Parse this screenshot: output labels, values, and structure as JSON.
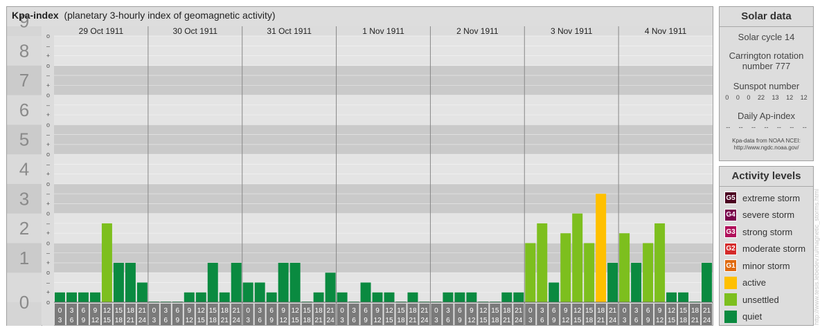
{
  "header": {
    "title_bold": "Kpa-index",
    "title_rest": "(planetary 3-hourly index of geomagnetic activity)"
  },
  "chart_data": {
    "type": "bar",
    "ylim": [
      0,
      9
    ],
    "y_ticks": [
      "0",
      "1",
      "2",
      "3",
      "4",
      "5",
      "6",
      "7",
      "8",
      "9"
    ],
    "sub_ticks": [
      "o",
      "+",
      "–"
    ],
    "days": [
      "29 Oct 1911",
      "30 Oct 1911",
      "31 Oct 1911",
      "1 Nov 1911",
      "2 Nov 1911",
      "3 Nov 1911",
      "4 Nov 1911"
    ],
    "hour_start": [
      "0",
      "3",
      "6",
      "9",
      "12",
      "15",
      "18",
      "21"
    ],
    "hour_end": [
      "3",
      "6",
      "9",
      "12",
      "15",
      "18",
      "21",
      "24"
    ],
    "values": [
      [
        0.333,
        0.333,
        0.333,
        0.333,
        2.667,
        1.333,
        1.333,
        0.667
      ],
      [
        0,
        0,
        0,
        0.333,
        0.333,
        1.333,
        0.333,
        1.333
      ],
      [
        0.667,
        0.667,
        0.333,
        1.333,
        1.333,
        0,
        0.333,
        1.0
      ],
      [
        0.333,
        0,
        0.667,
        0.333,
        0.333,
        0,
        0.333,
        0
      ],
      [
        0,
        0.333,
        0.333,
        0.333,
        0,
        0,
        0.333,
        0.333
      ],
      [
        2.0,
        2.667,
        0.667,
        2.333,
        3.0,
        2.0,
        3.667,
        1.333
      ],
      [
        2.333,
        1.333,
        2.0,
        2.667,
        0.333,
        0.333,
        0,
        1.333
      ]
    ]
  },
  "solar": {
    "title": "Solar data",
    "cycle": "Solar cycle 14",
    "carrington": "Carrington rotation number 777",
    "sunspot_label": "Sunspot number",
    "sunspot_values": [
      "0",
      "0",
      "0",
      "22",
      "13",
      "12",
      "12"
    ],
    "ap_label": "Daily Ap-index",
    "ap_values": [
      "--",
      "--",
      "--",
      "--",
      "--",
      "--",
      "--"
    ],
    "credit_line1": "Kpa-data from NOAA NCEI:",
    "credit_line2": "http://www.ngdc.noaa.gov/"
  },
  "activity": {
    "title": "Activity levels",
    "levels": [
      {
        "code": "G5",
        "label": "extreme storm",
        "color": "#4a0020"
      },
      {
        "code": "G4",
        "label": "severe storm",
        "color": "#78004a"
      },
      {
        "code": "G3",
        "label": "strong storm",
        "color": "#b0105a"
      },
      {
        "code": "G2",
        "label": "moderate storm",
        "color": "#d42a2a"
      },
      {
        "code": "G1",
        "label": "minor storm",
        "color": "#e06a10"
      },
      {
        "code": "",
        "label": "active",
        "color": "#ffc000"
      },
      {
        "code": "",
        "label": "unsettled",
        "color": "#7dbf1e"
      },
      {
        "code": "",
        "label": "quiet",
        "color": "#0a8a40"
      }
    ]
  },
  "watermark": "http://www.tesis.lebedev.ru/magnetic_storms.html"
}
